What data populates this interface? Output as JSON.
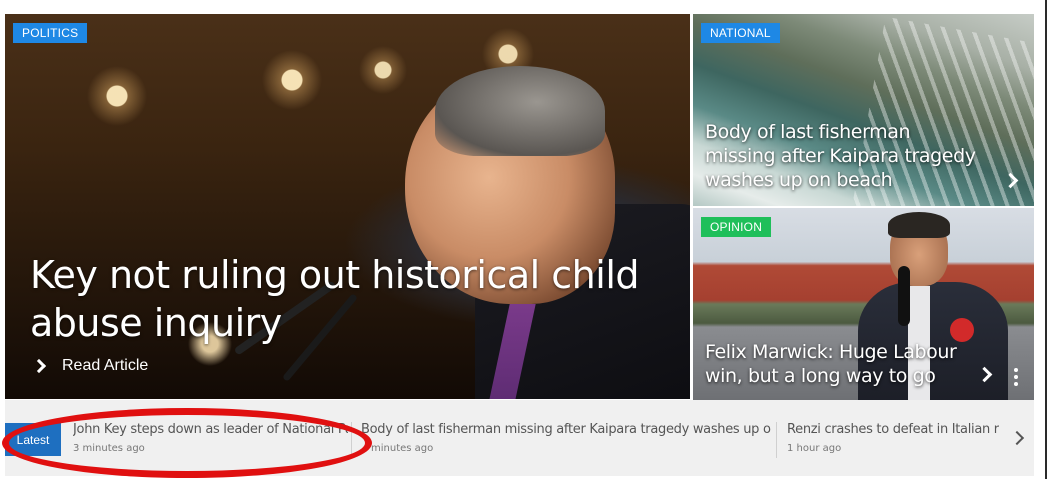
{
  "hero": {
    "tag": "POLITICS",
    "tag_color": "#1e88e5",
    "headline": "Key not ruling out historical child abuse inquiry",
    "cta": "Read Article"
  },
  "side_tiles": [
    {
      "tag": "NATIONAL",
      "tag_color": "#1e88e5",
      "headline": "Body of last fisherman missing after Kaipara tragedy washes up on beach"
    },
    {
      "tag": "OPINION",
      "tag_color": "#1fbf5a",
      "headline": "Felix Marwick: Huge Labour win, but a long way to go"
    }
  ],
  "latest": {
    "label": "Latest",
    "label_color": "#1e6fc0",
    "items": [
      {
        "title": "John Key steps down as leader of National Party",
        "time": "3 minutes ago"
      },
      {
        "title": "Body of last fisherman missing after Kaipara tragedy washes up on beach",
        "time": "minutes ago"
      },
      {
        "title": "Renzi crashes to defeat in Italian refere",
        "time": "1 hour ago"
      }
    ]
  },
  "annotation": {
    "color": "#e01010"
  }
}
